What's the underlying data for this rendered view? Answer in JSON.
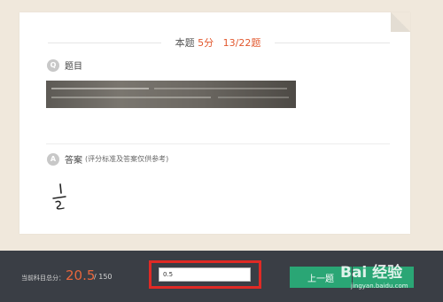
{
  "header": {
    "prefix": "本题",
    "points": "5分",
    "progress": "13/22题"
  },
  "question": {
    "badge": "Q",
    "title": "题目"
  },
  "answer": {
    "badge": "A",
    "title": "答案",
    "note": "(评分标准及答案仅供参考)"
  },
  "footer": {
    "total_label": "当前科目总分：",
    "total_score": "20.5",
    "total_max": "/ 150",
    "score_input_value": "0.5",
    "prev_button": "上一题",
    "next_button": ""
  },
  "watermark": {
    "main": "Bai 经验",
    "sub": "jingyan.baidu.com"
  },
  "colors": {
    "background": "#f0e8dc",
    "accent_red": "#e2582e",
    "button_green": "#2aa675",
    "bar": "#3a3e45",
    "highlight_box": "#e02a25"
  }
}
